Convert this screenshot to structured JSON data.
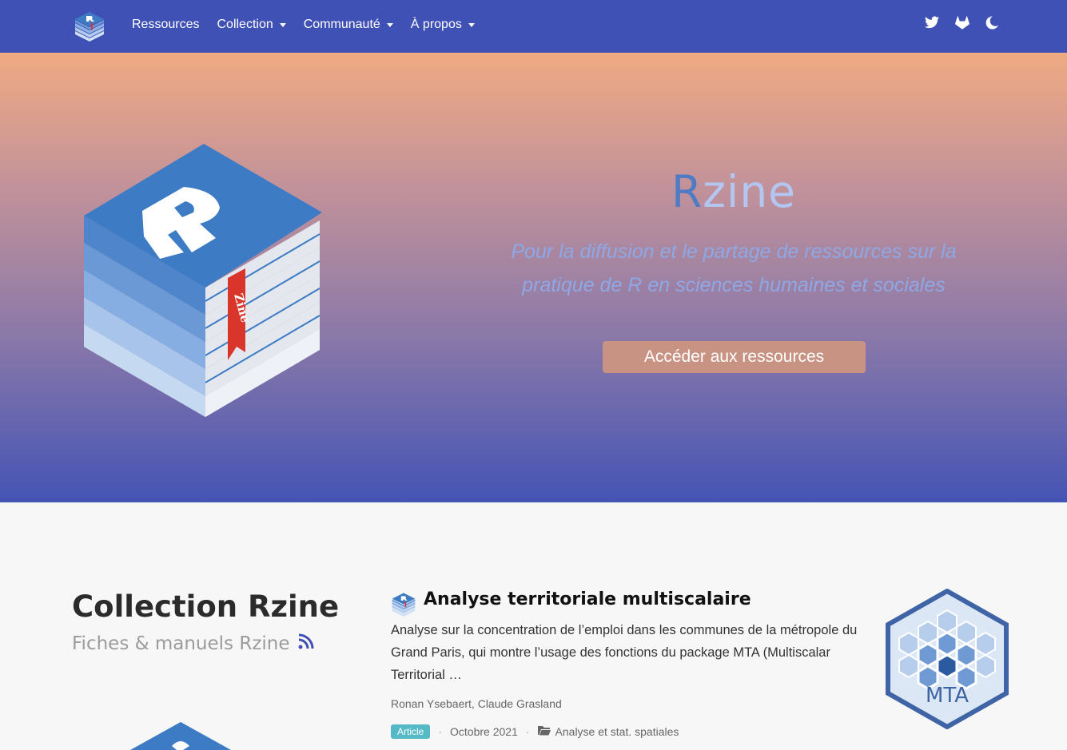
{
  "navbar": {
    "brand_icon": "rzine-logo-icon",
    "items": [
      {
        "label": "Ressources",
        "dropdown": false
      },
      {
        "label": "Collection",
        "dropdown": true
      },
      {
        "label": "Communauté",
        "dropdown": true
      },
      {
        "label": "À propos",
        "dropdown": true
      }
    ],
    "right_icons": [
      "twitter-icon",
      "gitlab-icon",
      "moon-icon"
    ],
    "background": "#3f51b5"
  },
  "hero": {
    "title_r": "R",
    "title_rest": "zine",
    "subtitle": "Pour la diffusion et le partage de ressources sur la pratique de R en sciences humaines et sociales",
    "button_label": "Accéder aux ressources",
    "logo_bookmark_text": "Zine",
    "logo_letter": "R"
  },
  "collection": {
    "heading": "Collection Rzine",
    "subheading": "Fiches & manuels Rzine",
    "subheading_icon": "rss-icon",
    "article": {
      "title": "Analyse territoriale multiscalaire",
      "summary": "Analyse sur la concentration de l’emploi dans les communes de la métropole du Grand Paris, qui montre l’usage des fonctions du package MTA (Multiscalar Territorial …",
      "authors": "Ronan Ysebaert, Claude Grasland",
      "badge": "Article",
      "date": "Octobre 2021",
      "category": "Analyse et stat. spatiales",
      "category_icon": "folder-icon",
      "image_label": "MTA"
    }
  },
  "colors": {
    "accent": "#3f51b5",
    "badge": "#55b9c6",
    "button": "#c99383",
    "logo_blue": "#3d7cc4"
  }
}
